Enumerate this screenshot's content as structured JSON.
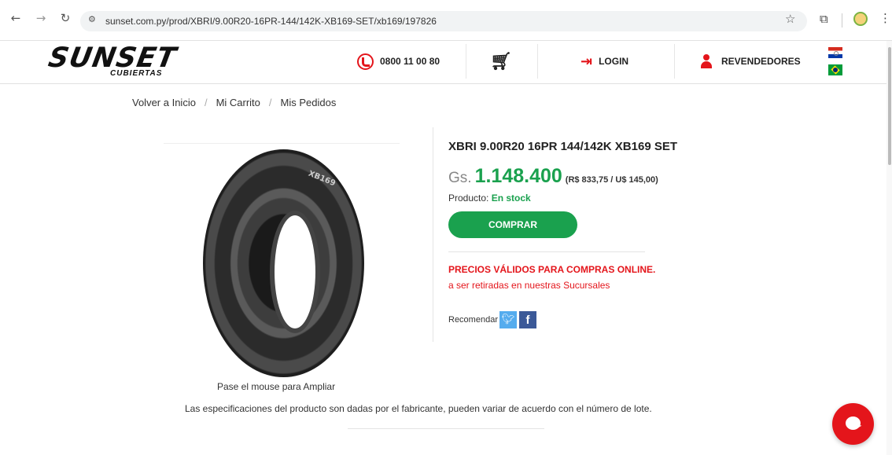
{
  "browser": {
    "url": "sunset.com.py/prod/XBRI/9.00R20-16PR-144/142K-XB169-SET/xb169/197826",
    "icons": [
      "back-arrow-icon",
      "forward-arrow-icon",
      "reload-icon",
      "site-settings-icon",
      "bookmark-star-icon",
      "extensions-icon",
      "profile-icon",
      "more-menu-icon"
    ]
  },
  "header": {
    "logo_text": "SUNSET",
    "logo_subtext": "CUBIERTAS",
    "phone": "0800 11 00 80",
    "login": "LOGIN",
    "resellers": "REVENDEDORES",
    "languages": [
      "Paraguay flag",
      "Brazil flag"
    ],
    "accent_color": "#e4151b"
  },
  "breadcrumb": {
    "items": [
      "Volver a Inicio",
      "Mi Carrito",
      "Mis Pedidos"
    ],
    "separator": "/"
  },
  "product": {
    "title": "XBRI 9.00R20 16PR 144/142K XB169 SET",
    "image_brand_mark": "XB169",
    "zoom_hint": "Pase el mouse para Ampliar",
    "currency": "Gs.",
    "price": "1.148.400",
    "alt_price": "(R$ 833,75 / U$ 145,00)",
    "stock_label": "Producto:",
    "stock_value": "En stock",
    "buy_button": "COMPRAR",
    "promo_title": "PRECIOS VÁLIDOS PARA COMPRAS ONLINE.",
    "promo_subtitle": "a ser retiradas en nuestras Sucursales",
    "share_label": "Recomendar",
    "price_color": "#1aa14e"
  },
  "disclaimer": "Las especificaciones del producto son dadas por el fabricante, pueden variar de acuerdo con el número de lote."
}
